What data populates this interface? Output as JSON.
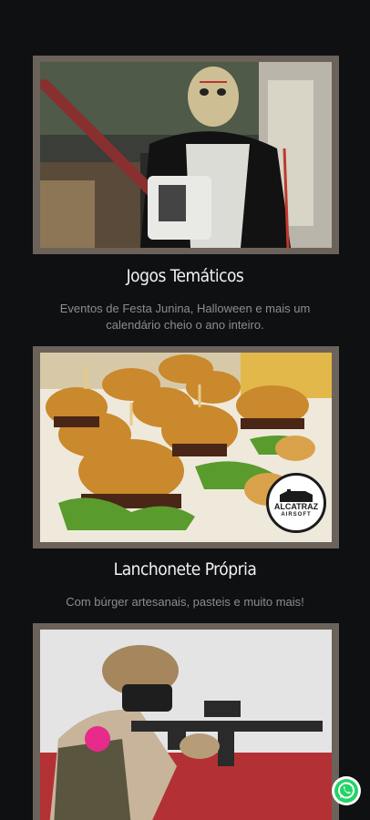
{
  "cards": [
    {
      "title": "Jogos Temáticos",
      "description": "Eventos de Festa Junina, Halloween e mais um calendário cheio o ano inteiro.",
      "image": "halloween-chainsaw-photo"
    },
    {
      "title": "Lanchonete Própria",
      "description": "Com búrger artesanais, pasteis e muito mais!",
      "image": "burgers-photo",
      "badge": {
        "line1": "ALCATRAZ",
        "line2": "AIRSOFT"
      }
    },
    {
      "title": "",
      "description": "",
      "image": "airsoft-player-photo"
    }
  ],
  "floating": {
    "whatsapp_icon": "whatsapp-icon",
    "color": "#25d366"
  }
}
